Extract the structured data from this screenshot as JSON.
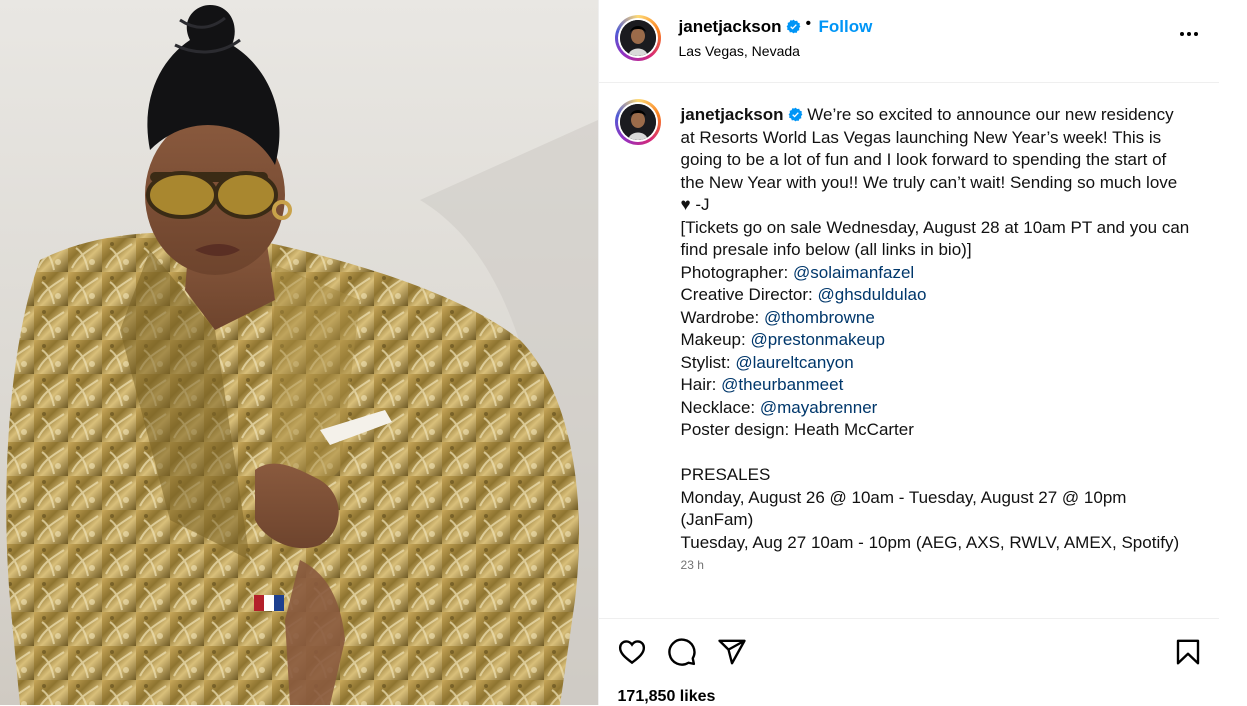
{
  "post": {
    "username": "janetjackson",
    "follow_label": "Follow",
    "separator": "•",
    "location": "Las Vegas, Nevada",
    "verified_icon": "verified-badge-icon",
    "more_icon": "more-options-icon"
  },
  "caption": {
    "username": "janetjackson",
    "lines": [
      "We’re so excited to announce our new residency at Resorts World Las Vegas launching New Year’s week! This is going to be a lot of fun and I look forward to spending the start of the New Year with you!! We truly can’t wait! Sending so much love ♥ -J",
      "",
      "[Tickets go on sale Wednesday, August 28 at 10am PT and you can find presale info below (all links in bio)]",
      ""
    ],
    "credits": [
      {
        "label": "Photographer: ",
        "handle": "@solaimanfazel"
      },
      {
        "label": "Creative Director: ",
        "handle": "@ghsduldulao"
      },
      {
        "label": "Wardrobe: ",
        "handle": "@thombrowne"
      },
      {
        "label": "Makeup: ",
        "handle": "@prestonmakeup"
      },
      {
        "label": "Stylist: ",
        "handle": "@laureltcanyon"
      },
      {
        "label": "Hair: ",
        "handle": "@theurbanmeet"
      },
      {
        "label": "Necklace: ",
        "handle": "@mayabrenner"
      }
    ],
    "poster_design": "Poster design: Heath McCarter",
    "presales_title": "PRESALES",
    "presale_1": "Monday, August 26 @ 10am - Tuesday, August 27 @ 10pm (JanFam)",
    "presale_2": "Tuesday, Aug 27 10am - 10pm (AEG, AXS, RWLV, AMEX, Spotify)",
    "timestamp": "23 h"
  },
  "actions": {
    "like_icon": "heart-icon",
    "comment_icon": "comment-icon",
    "share_icon": "share-icon",
    "save_icon": "bookmark-icon",
    "likes": "171,850 likes"
  },
  "colors": {
    "link": "#00376b",
    "follow": "#0095f6",
    "verified": "#0095f6"
  }
}
